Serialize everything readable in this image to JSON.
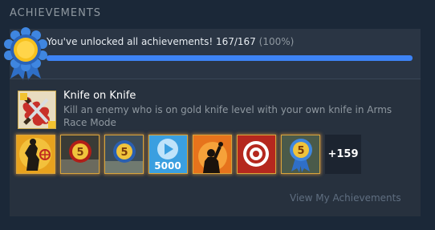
{
  "section": {
    "title": "ACHIEVEMENTS"
  },
  "summary": {
    "text": "You've unlocked all achievements! 167/167",
    "percent_text": "(100%)",
    "unlocked": 167,
    "total": 167,
    "progress_fraction": 1.0,
    "medal_icon": "gold-ribbon-medal-icon"
  },
  "featured": {
    "title": "Knife on Knife",
    "description": "Kill an enemy who is on gold knife level with your own knife in Arms Race Mode",
    "icon": "crossed-knives-icon"
  },
  "achievements": [
    {
      "icon": "soldier-target-icon"
    },
    {
      "icon": "medal-5-red-icon"
    },
    {
      "icon": "medal-5-blue-icon"
    },
    {
      "icon": "play-5000-icon",
      "label": "5000"
    },
    {
      "icon": "silhouette-grenade-icon"
    },
    {
      "icon": "bullseye-icon"
    },
    {
      "icon": "ribbon-medal-5-icon"
    }
  ],
  "more": {
    "label": "+159"
  },
  "footer": {
    "link_label": "View My Achievements"
  },
  "colors": {
    "background": "#1b2838",
    "panel": "#27313e",
    "progress_fill": "#3d83f5",
    "gold_border": "#d9a53c",
    "muted_text": "#8f98a0"
  }
}
